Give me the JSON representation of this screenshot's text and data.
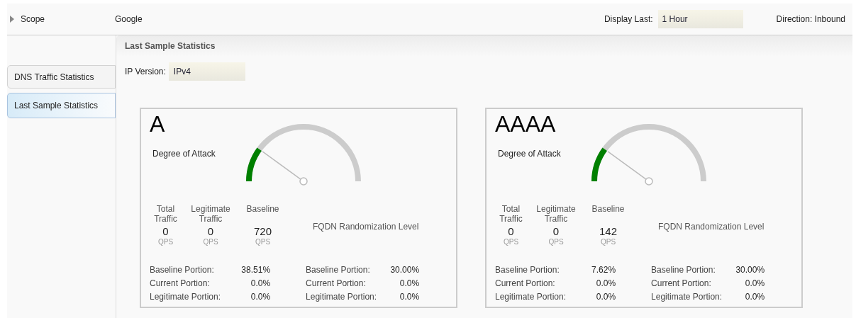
{
  "top_bar": {
    "scope": {
      "label": "Scope",
      "expanded": false
    },
    "scope_value": "Google",
    "display_last": {
      "label": "Display Last:",
      "value": "1 Hour"
    },
    "direction": "Direction: Inbound"
  },
  "side_tabs": [
    {
      "label": "DNS Traffic Statistics",
      "selected": false
    },
    {
      "label": "Last Sample Statistics",
      "selected": true
    }
  ],
  "panel": {
    "title": "Last Sample Statistics",
    "ip_version": {
      "label": "IP Version:",
      "value": "IPv4"
    },
    "cards": [
      {
        "title": "A",
        "degree_of_attack": {
          "label": "Degree of Attack"
        },
        "stats": [
          {
            "label": "Total Traffic",
            "value": "0",
            "unit": "QPS"
          },
          {
            "label": "Legitimate Traffic",
            "value": "0",
            "unit": "QPS"
          },
          {
            "label": "Baseline",
            "value": "720",
            "unit": "QPS"
          }
        ],
        "portions": [
          {
            "label": "Baseline Portion:",
            "value": "38.51%"
          },
          {
            "label": "Current Portion:",
            "value": "0.0%"
          },
          {
            "label": "Legitimate Portion:",
            "value": "0.0%"
          }
        ],
        "fqdn": {
          "label": "FQDN Randomization Level",
          "portions": [
            {
              "label": "Baseline Portion:",
              "value": "30.00%"
            },
            {
              "label": "Current Portion:",
              "value": "0.0%"
            },
            {
              "label": "Legitimate Portion:",
              "value": "0.0%"
            }
          ]
        }
      },
      {
        "title": "AAAA",
        "degree_of_attack": {
          "label": "Degree of Attack"
        },
        "stats": [
          {
            "label": "Total Traffic",
            "value": "0",
            "unit": "QPS"
          },
          {
            "label": "Legitimate Traffic",
            "value": "0",
            "unit": "QPS"
          },
          {
            "label": "Baseline",
            "value": "142",
            "unit": "QPS"
          }
        ],
        "portions": [
          {
            "label": "Baseline Portion:",
            "value": "7.62%"
          },
          {
            "label": "Current Portion:",
            "value": "0.0%"
          },
          {
            "label": "Legitimate Portion:",
            "value": "0.0%"
          }
        ],
        "fqdn": {
          "label": "FQDN Randomization Level",
          "portions": [
            {
              "label": "Baseline Portion:",
              "value": "30.00%"
            },
            {
              "label": "Current Portion:",
              "value": "0.0%"
            },
            {
              "label": "Legitimate Portion:",
              "value": "0.0%"
            }
          ]
        }
      }
    ]
  }
}
